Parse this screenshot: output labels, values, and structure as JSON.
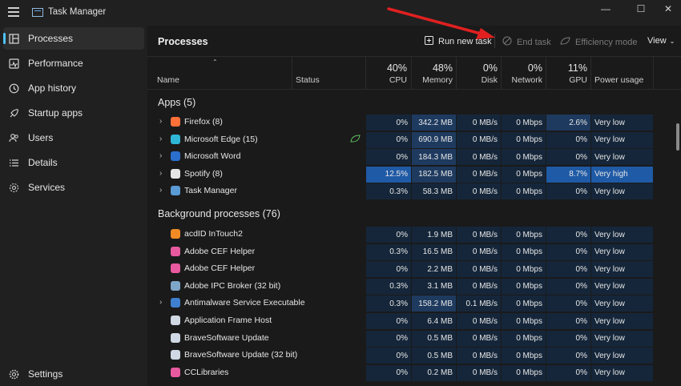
{
  "app": {
    "title": "Task Manager"
  },
  "window_controls": {
    "minimize": "—",
    "maximize": "☐",
    "close": "✕"
  },
  "sidebar": {
    "items": [
      {
        "label": "Processes",
        "icon": "processes-icon",
        "active": true
      },
      {
        "label": "Performance",
        "icon": "performance-icon"
      },
      {
        "label": "App history",
        "icon": "app-history-icon"
      },
      {
        "label": "Startup apps",
        "icon": "startup-apps-icon"
      },
      {
        "label": "Users",
        "icon": "users-icon"
      },
      {
        "label": "Details",
        "icon": "details-icon"
      },
      {
        "label": "Services",
        "icon": "services-icon"
      }
    ],
    "settings": {
      "label": "Settings",
      "icon": "gear-icon"
    }
  },
  "toolbar": {
    "title": "Processes",
    "run_new_task": "Run new task",
    "end_task": "End task",
    "efficiency_mode": "Efficiency mode",
    "view": "View"
  },
  "columns": {
    "name": "Name",
    "status": "Status",
    "cpu": {
      "pct": "40%",
      "label": "CPU"
    },
    "memory": {
      "pct": "48%",
      "label": "Memory"
    },
    "disk": {
      "pct": "0%",
      "label": "Disk"
    },
    "network": {
      "pct": "0%",
      "label": "Network"
    },
    "gpu": {
      "pct": "11%",
      "label": "GPU"
    },
    "power": {
      "label": "Power usage"
    }
  },
  "groups": {
    "apps": "Apps (5)",
    "background": "Background processes (76)"
  },
  "apps": [
    {
      "name": "Firefox (8)",
      "expand": true,
      "status": "",
      "cpu": "0%",
      "memory": "342.2 MB",
      "disk": "0 MB/s",
      "network": "0 Mbps",
      "gpu": "2.6%",
      "power": "Very low",
      "icon_color": "#ff7139"
    },
    {
      "name": "Microsoft Edge (15)",
      "expand": true,
      "status": "leaf",
      "cpu": "0%",
      "memory": "690.9 MB",
      "disk": "0 MB/s",
      "network": "0 Mbps",
      "gpu": "0%",
      "power": "Very low",
      "icon_color": "#2fb5d6"
    },
    {
      "name": "Microsoft Word",
      "expand": true,
      "status": "",
      "cpu": "0%",
      "memory": "184.3 MB",
      "disk": "0 MB/s",
      "network": "0 Mbps",
      "gpu": "0%",
      "power": "Very low",
      "icon_color": "#2b6fce"
    },
    {
      "name": "Spotify (8)",
      "expand": true,
      "status": "",
      "cpu": "12.5%",
      "memory": "182.5 MB",
      "disk": "0 MB/s",
      "network": "0 Mbps",
      "gpu": "8.7%",
      "power": "Very high",
      "icon_color": "#e6e6e6"
    },
    {
      "name": "Task Manager",
      "expand": true,
      "status": "",
      "cpu": "0.3%",
      "memory": "58.3 MB",
      "disk": "0 MB/s",
      "network": "0 Mbps",
      "gpu": "0%",
      "power": "Very low",
      "icon_color": "#5b9bd5"
    }
  ],
  "background": [
    {
      "name": "acdID InTouch2",
      "expand": false,
      "cpu": "0%",
      "memory": "1.9 MB",
      "disk": "0 MB/s",
      "network": "0 Mbps",
      "gpu": "0%",
      "power": "Very low",
      "icon_color": "#f08a24"
    },
    {
      "name": "Adobe CEF Helper",
      "expand": false,
      "cpu": "0.3%",
      "memory": "16.5 MB",
      "disk": "0 MB/s",
      "network": "0 Mbps",
      "gpu": "0%",
      "power": "Very low",
      "icon_color": "#e85aa0"
    },
    {
      "name": "Adobe CEF Helper",
      "expand": false,
      "cpu": "0%",
      "memory": "2.2 MB",
      "disk": "0 MB/s",
      "network": "0 Mbps",
      "gpu": "0%",
      "power": "Very low",
      "icon_color": "#e85aa0"
    },
    {
      "name": "Adobe IPC Broker (32 bit)",
      "expand": false,
      "cpu": "0.3%",
      "memory": "3.1 MB",
      "disk": "0 MB/s",
      "network": "0 Mbps",
      "gpu": "0%",
      "power": "Very low",
      "icon_color": "#7ea6c8"
    },
    {
      "name": "Antimalware Service Executable",
      "expand": true,
      "cpu": "0.3%",
      "memory": "158.2 MB",
      "disk": "0.1 MB/s",
      "network": "0 Mbps",
      "gpu": "0%",
      "power": "Very low",
      "icon_color": "#3f7fd0"
    },
    {
      "name": "Application Frame Host",
      "expand": false,
      "cpu": "0%",
      "memory": "6.4 MB",
      "disk": "0 MB/s",
      "network": "0 Mbps",
      "gpu": "0%",
      "power": "Very low",
      "icon_color": "#cfd8e3"
    },
    {
      "name": "BraveSoftware Update",
      "expand": false,
      "cpu": "0%",
      "memory": "0.5 MB",
      "disk": "0 MB/s",
      "network": "0 Mbps",
      "gpu": "0%",
      "power": "Very low",
      "icon_color": "#cfd8e3"
    },
    {
      "name": "BraveSoftware Update (32 bit)",
      "expand": false,
      "cpu": "0%",
      "memory": "0.5 MB",
      "disk": "0 MB/s",
      "network": "0 Mbps",
      "gpu": "0%",
      "power": "Very low",
      "icon_color": "#cfd8e3"
    },
    {
      "name": "CCLibraries",
      "expand": false,
      "cpu": "0%",
      "memory": "0.2 MB",
      "disk": "0 MB/s",
      "network": "0 Mbps",
      "gpu": "0%",
      "power": "Very low",
      "icon_color": "#e85aa0"
    }
  ],
  "colors": {
    "accent": "#4cc2ff",
    "cell_bg": "#15263a",
    "cell_med": "#1e3a5f",
    "cell_high": "#1f5aa6",
    "arrow": "#e02020"
  }
}
